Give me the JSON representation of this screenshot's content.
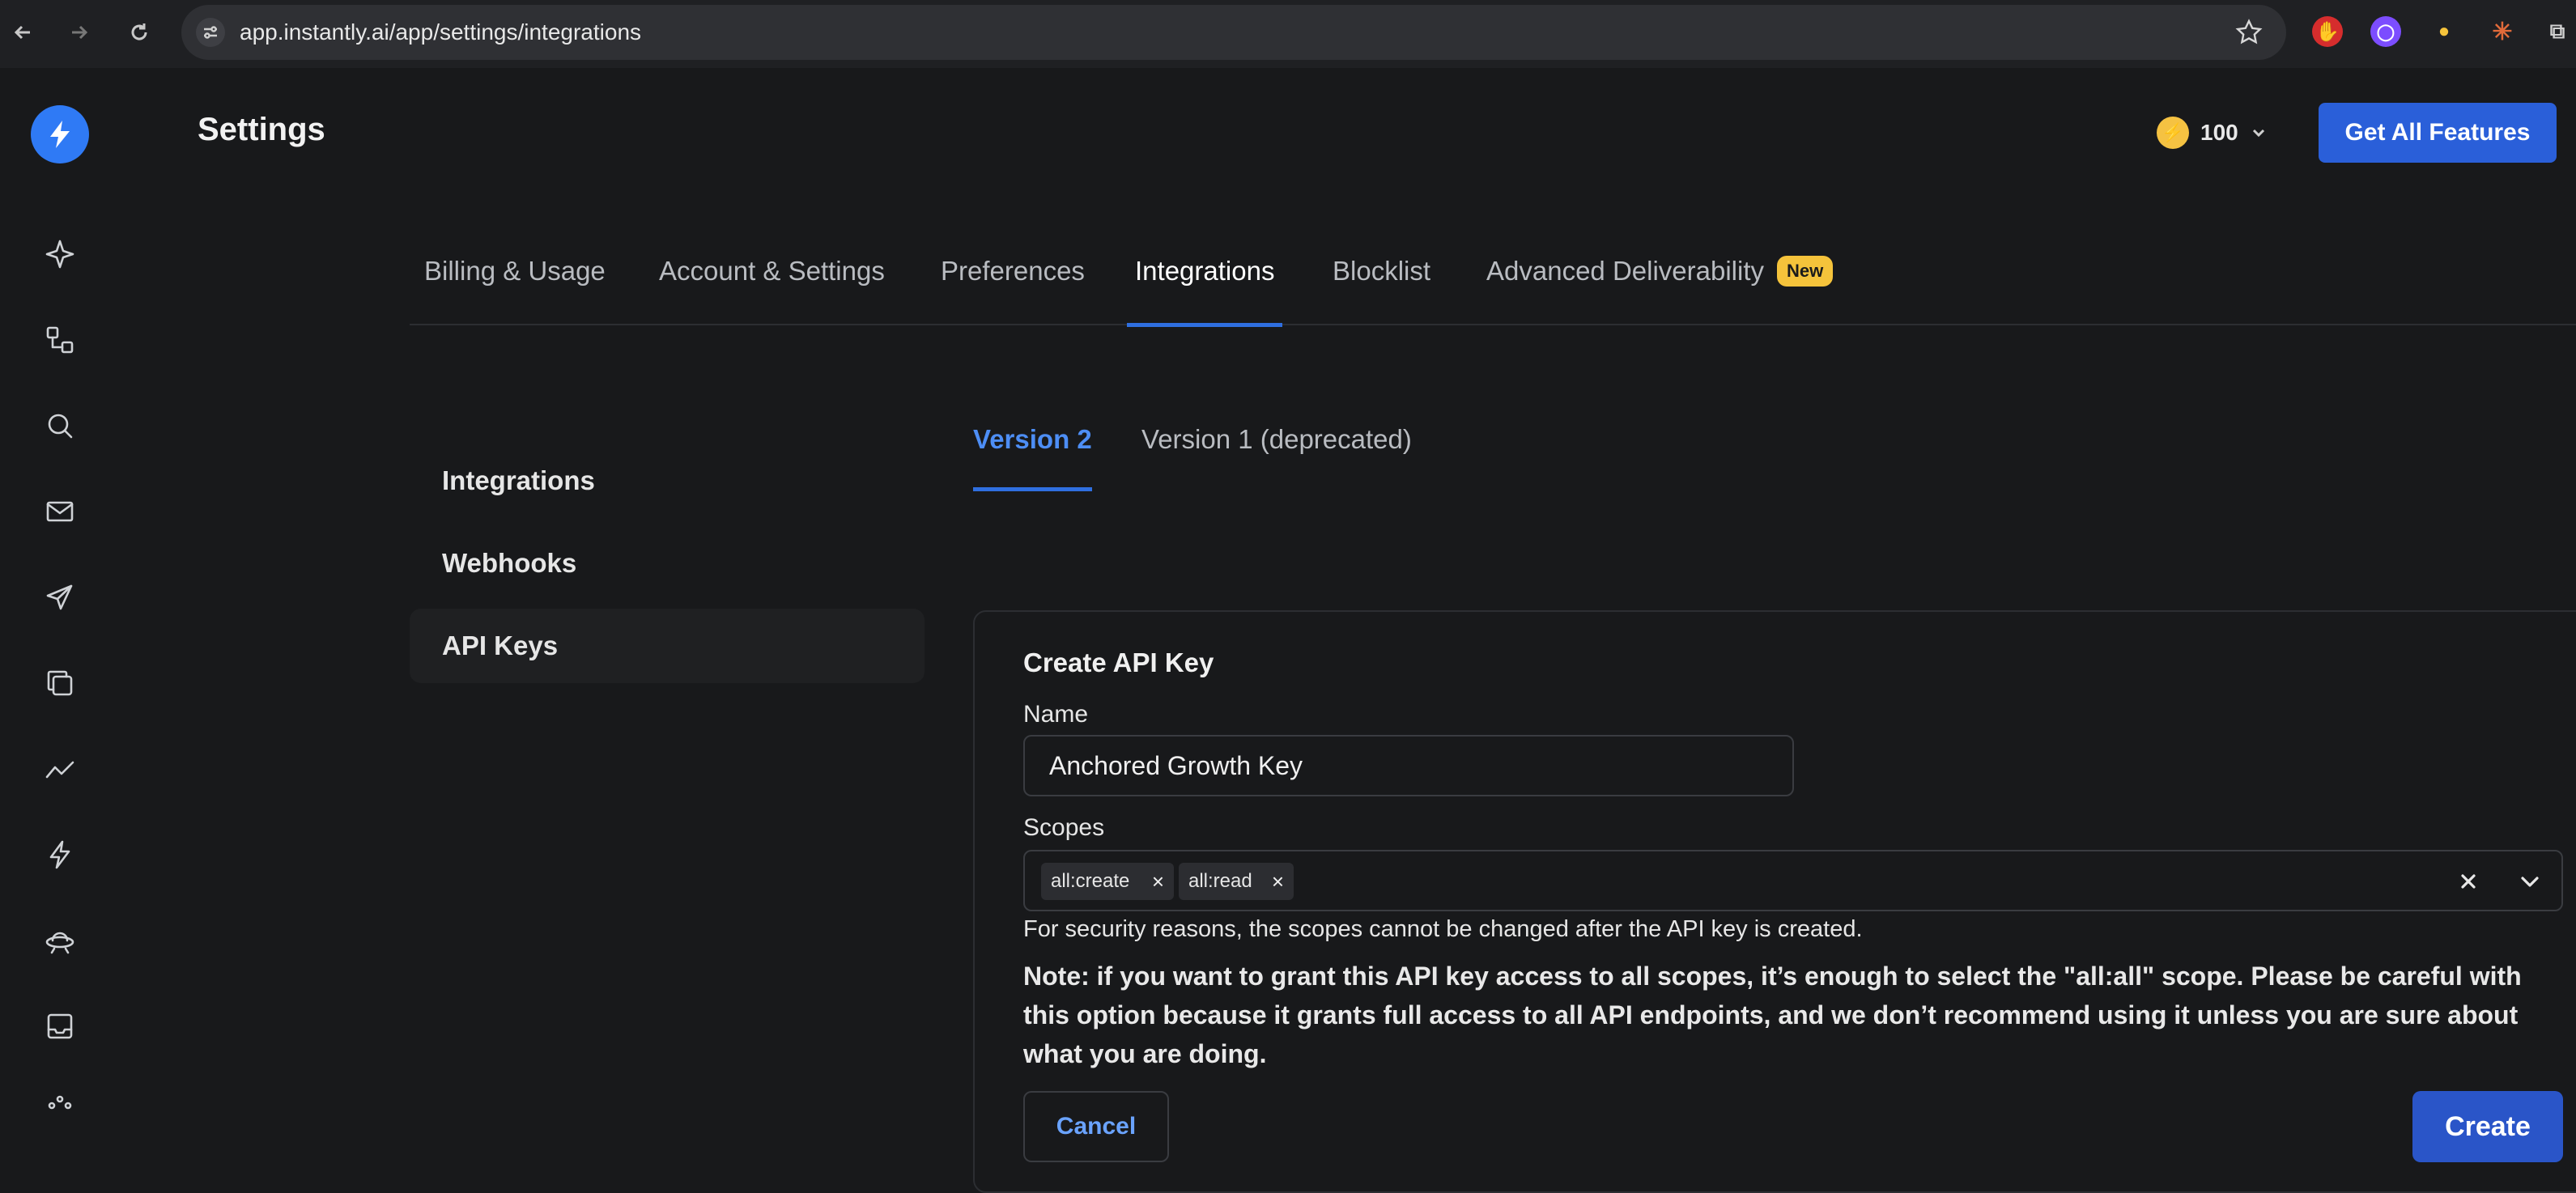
{
  "browser": {
    "url": "app.instantly.ai/app/settings/integrations",
    "extensions": [
      "hand-extension-icon",
      "github-extension-icon",
      "lemon-extension-icon",
      "claude-extension-icon",
      "puzzle-extension-icon"
    ]
  },
  "header": {
    "title": "Settings",
    "credits": "100",
    "cta_label": "Get All Features"
  },
  "leftnav": {
    "icons": [
      "sparkle-icon",
      "workflow-icon",
      "search-icon",
      "mail-icon",
      "send-icon",
      "copy-icon",
      "analytics-icon",
      "lightning-icon",
      "ufo-icon",
      "inbox-icon",
      "more-icon"
    ]
  },
  "tabs": [
    {
      "label": "Billing & Usage"
    },
    {
      "label": "Account & Settings"
    },
    {
      "label": "Preferences"
    },
    {
      "label": "Integrations",
      "active": true
    },
    {
      "label": "Blocklist"
    },
    {
      "label": "Advanced Deliverability",
      "badge": "New"
    }
  ],
  "sidemenu": [
    {
      "label": "Integrations"
    },
    {
      "label": "Webhooks"
    },
    {
      "label": "API Keys",
      "selected": true
    }
  ],
  "version_tabs": [
    {
      "label": "Version 2",
      "active": true
    },
    {
      "label": "Version 1 (deprecated)"
    }
  ],
  "form": {
    "title": "Create API Key",
    "name_label": "Name",
    "name_value": "Anchored Growth Key",
    "scopes_label": "Scopes",
    "scopes": [
      "all:create",
      "all:read"
    ],
    "hint": "For security reasons, the scopes cannot be changed after the API key is created.",
    "note": "Note: if you want to grant this API key access to all scopes, it’s enough to select the \"all:all\" scope. Please be careful with this option because it grants full access to all API endpoints, and we don’t recommend using it unless you are sure about what you are doing.",
    "cancel_label": "Cancel",
    "create_label": "Create"
  },
  "colors": {
    "accent": "#2f6fe0",
    "badge": "#f5c33b",
    "primary_button": "#2a55c8"
  }
}
